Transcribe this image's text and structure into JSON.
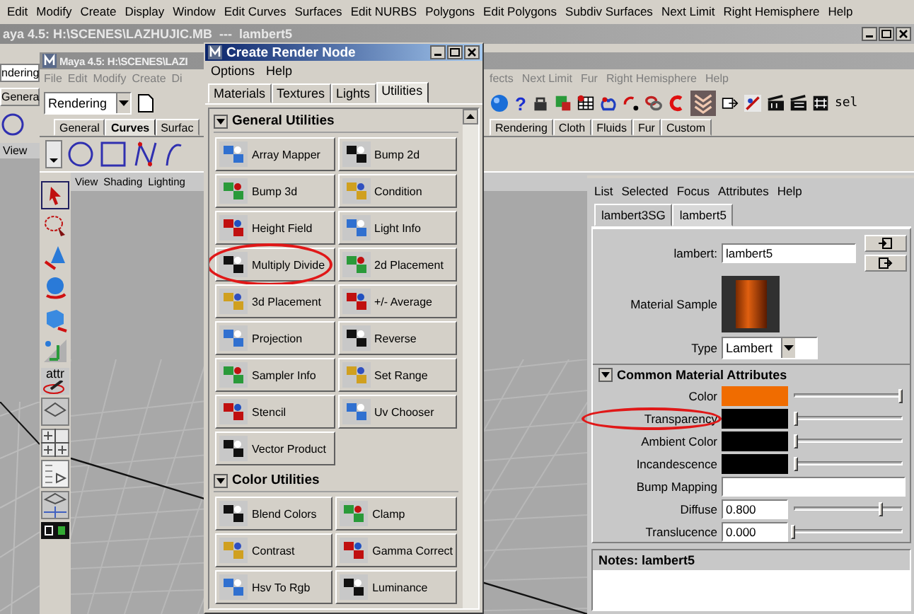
{
  "top_menu": [
    "Edit",
    "Modify",
    "Create",
    "Display",
    "Window",
    "Edit Curves",
    "Surfaces",
    "Edit NURBS",
    "Polygons",
    "Edit Polygons",
    "Subdiv Surfaces",
    "Next Limit",
    "Right Hemisphere",
    "Help"
  ],
  "back_window": {
    "title": "aya 4.5: H:\\SCENES\\LAZHUJIC.MB  ---  lambert5",
    "mode_dropdown": "ndering",
    "shelf_tab": "Genera",
    "viewport_menu": "View"
  },
  "main_window": {
    "title": "Maya 4.5: H:\\SCENES\\LAZI",
    "menu_left": [
      "File",
      "Edit",
      "Modify",
      "Create",
      "Di"
    ],
    "menu_right": [
      "fects",
      "Next Limit",
      "Fur",
      "Right Hemisphere",
      "Help"
    ],
    "mode_dropdown": "Rendering",
    "help_button": "?",
    "selection_menu": "sel",
    "shelf_tabs_left": [
      {
        "label": "General",
        "selected": false
      },
      {
        "label": "Curves",
        "selected": true
      },
      {
        "label": "Surfac",
        "selected": false
      }
    ],
    "shelf_tabs_right": [
      {
        "label": "Rendering",
        "selected": false
      },
      {
        "label": "Cloth",
        "selected": false
      },
      {
        "label": "Fluids",
        "selected": false
      },
      {
        "label": "Fur",
        "selected": false
      },
      {
        "label": "Custom",
        "selected": false
      }
    ],
    "toolbox_label": "attr",
    "viewport_menu": [
      "View",
      "Shading",
      "Lighting"
    ]
  },
  "render_node_dialog": {
    "title": "Create Render Node",
    "menu": [
      "Options",
      "Help"
    ],
    "tabs": [
      {
        "label": "Materials",
        "selected": false
      },
      {
        "label": "Textures",
        "selected": false
      },
      {
        "label": "Lights",
        "selected": false
      },
      {
        "label": "Utilities",
        "selected": true
      }
    ],
    "sections": [
      {
        "title": "General Utilities",
        "expanded": true,
        "items": [
          {
            "label": "Array Mapper",
            "highlighted": false
          },
          {
            "label": "Bump 2d",
            "highlighted": false
          },
          {
            "label": "Bump 3d",
            "highlighted": false
          },
          {
            "label": "Condition",
            "highlighted": false
          },
          {
            "label": "Height Field",
            "highlighted": false
          },
          {
            "label": "Light Info",
            "highlighted": false
          },
          {
            "label": "Multiply Divide",
            "highlighted": true
          },
          {
            "label": "2d Placement",
            "highlighted": false
          },
          {
            "label": "3d Placement",
            "highlighted": false
          },
          {
            "label": "+/- Average",
            "highlighted": false
          },
          {
            "label": "Projection",
            "highlighted": false
          },
          {
            "label": "Reverse",
            "highlighted": false
          },
          {
            "label": "Sampler Info",
            "highlighted": false
          },
          {
            "label": "Set Range",
            "highlighted": false
          },
          {
            "label": "Stencil",
            "highlighted": false
          },
          {
            "label": "Uv Chooser",
            "highlighted": false
          },
          {
            "label": "Vector Product",
            "highlighted": false
          }
        ]
      },
      {
        "title": "Color Utilities",
        "expanded": true,
        "items": [
          {
            "label": "Blend Colors",
            "highlighted": false
          },
          {
            "label": "Clamp",
            "highlighted": false
          },
          {
            "label": "Contrast",
            "highlighted": false
          },
          {
            "label": "Gamma Correct",
            "highlighted": false
          },
          {
            "label": "Hsv To Rgb",
            "highlighted": false
          },
          {
            "label": "Luminance",
            "highlighted": false
          }
        ]
      }
    ]
  },
  "attribute_editor": {
    "menu": [
      "List",
      "Selected",
      "Focus",
      "Attributes",
      "Help"
    ],
    "tabs": [
      {
        "label": "lambert3SG",
        "selected": false
      },
      {
        "label": "lambert5",
        "selected": true
      }
    ],
    "name_label": "lambert:",
    "name_value": "lambert5",
    "sample_label": "Material Sample",
    "type_label": "Type",
    "type_value": "Lambert",
    "section_title": "Common Material Attributes",
    "section_expanded": true,
    "attributes": [
      {
        "kind": "color",
        "label": "Color",
        "color": "#f06c00",
        "level": 0.98,
        "highlighted": false
      },
      {
        "kind": "color",
        "label": "Transparency",
        "color": "#000000",
        "level": 0.02,
        "highlighted": true
      },
      {
        "kind": "color",
        "label": "Ambient Color",
        "color": "#000000",
        "level": 0.02,
        "highlighted": false
      },
      {
        "kind": "color",
        "label": "Incandescence",
        "color": "#000000",
        "level": 0.02,
        "highlighted": false
      },
      {
        "kind": "map",
        "label": "Bump Mapping",
        "highlighted": false
      },
      {
        "kind": "number",
        "label": "Diffuse",
        "value": "0.800",
        "level": 0.8,
        "highlighted": false
      },
      {
        "kind": "number",
        "label": "Translucence",
        "value": "0.000",
        "level": 0.0,
        "highlighted": false
      }
    ],
    "notes_title": "Notes: lambert5"
  }
}
